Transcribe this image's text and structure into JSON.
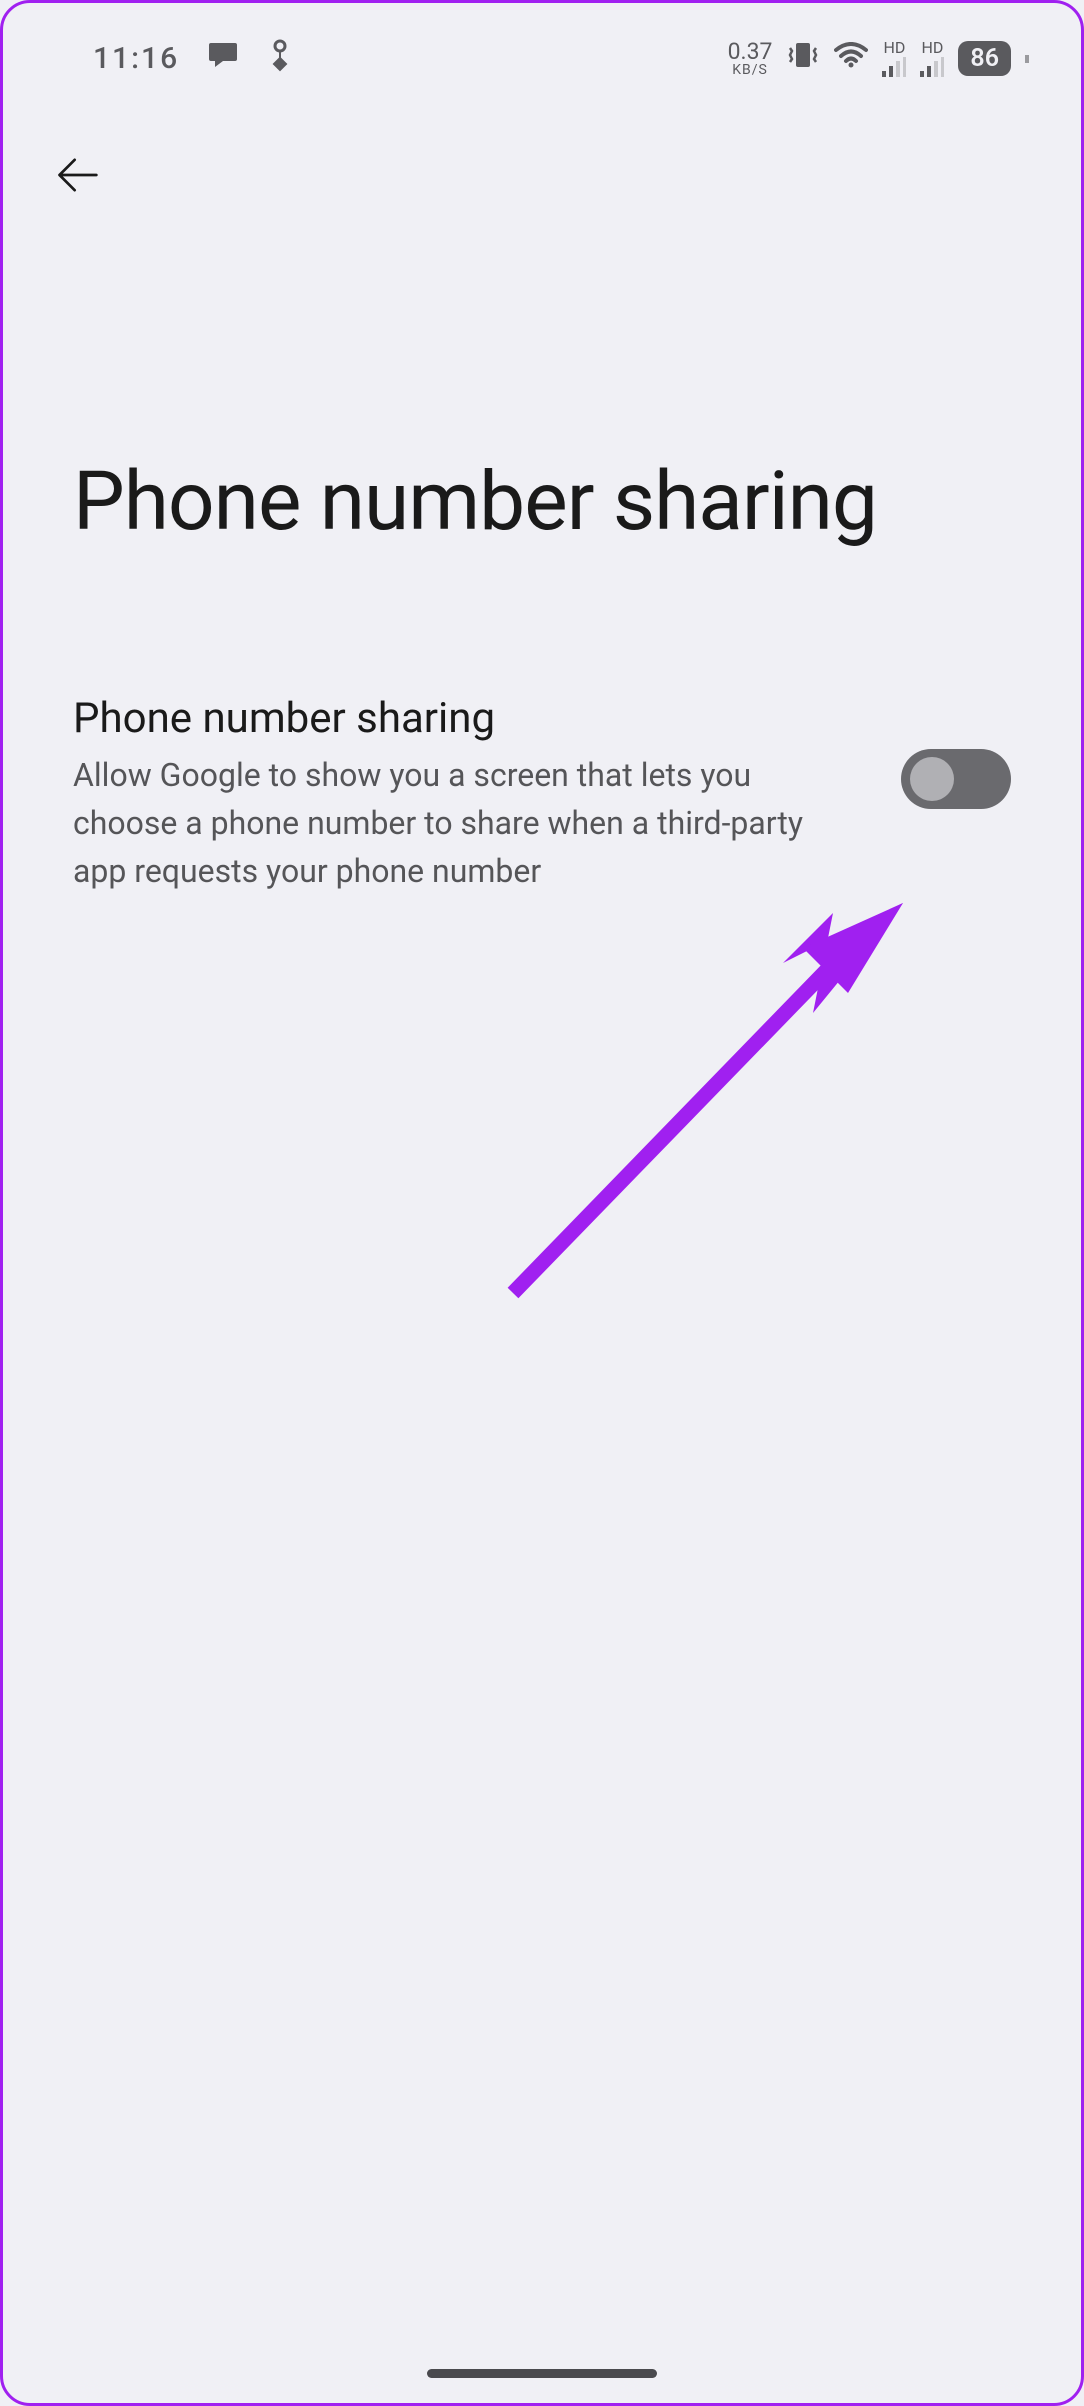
{
  "status_bar": {
    "time": "11:16",
    "data_rate": "0.37",
    "data_unit": "KB/S",
    "signal1_label": "HD",
    "signal2_label": "HD",
    "battery": "86"
  },
  "page": {
    "title": "Phone number sharing"
  },
  "setting": {
    "title": "Phone number sharing",
    "description": "Allow Google to show you a screen that lets you choose a phone number to share when a third-party app requests your phone number",
    "toggle_on": false
  },
  "annotation": {
    "arrow_color": "#a020f0"
  }
}
